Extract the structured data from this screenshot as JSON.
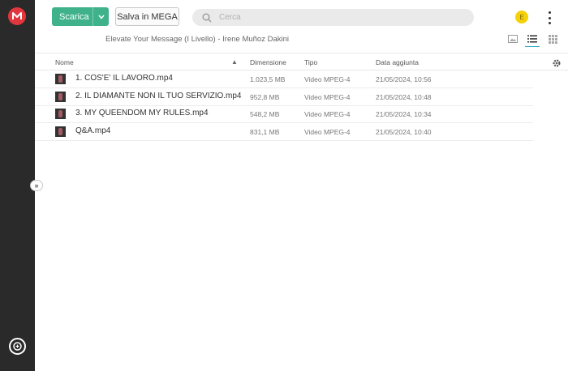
{
  "colors": {
    "rail_bg": "#2a2a2a",
    "brand_red": "#e2363e",
    "download_green": "#3fb28b",
    "avatar_yellow": "#f5d10a",
    "active_view_accent": "#2aa6c6"
  },
  "sidebar": {
    "logo_icon": "mega-logo-icon",
    "bottom_icon": "transfer-manager-icon",
    "expand_icon": "chevron-double-right-icon"
  },
  "toolbar": {
    "download_label": "Scarica",
    "save_label": "Salva in MEGA",
    "search_placeholder": "Cerca",
    "avatar_initial": "E"
  },
  "breadcrumb": {
    "folder_name": "Elevate Your Message (I Livello) - Irene Muñoz Dakini"
  },
  "view_toggles": [
    "thumbnail-view-icon",
    "list-view-icon",
    "grid-view-icon"
  ],
  "active_view": "list",
  "table": {
    "columns": {
      "name": "Nome",
      "size": "Dimensione",
      "type": "Tipo",
      "date": "Data aggiunta"
    },
    "rows": [
      {
        "name": "1. COS'E' IL LAVORO.mp4",
        "size": "1.023,5 MB",
        "type": "Video MPEG-4",
        "date": "21/05/2024, 10:56"
      },
      {
        "name": "2. IL DIAMANTE NON IL TUO SERVIZIO.mp4",
        "size": "952,8 MB",
        "type": "Video MPEG-4",
        "date": "21/05/2024, 10:48"
      },
      {
        "name": "3. MY QUEENDOM MY RULES.mp4",
        "size": "548,2 MB",
        "type": "Video MPEG-4",
        "date": "21/05/2024, 10:34"
      },
      {
        "name": "Q&A.mp4",
        "size": "831,1 MB",
        "type": "Video MPEG-4",
        "date": "21/05/2024, 10:40"
      }
    ]
  }
}
